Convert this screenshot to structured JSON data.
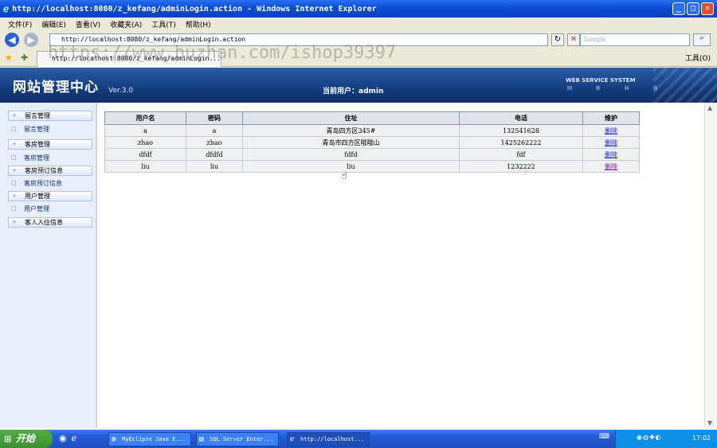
{
  "window": {
    "title": "http://localhost:8080/z_kefang/adminLogin.action - Windows Internet Explorer"
  },
  "menu": [
    "文件(F)",
    "编辑(E)",
    "查看(V)",
    "收藏夹(A)",
    "工具(T)",
    "帮助(H)"
  ],
  "address": {
    "url": "http://localhost:8080/z_kefang/adminLogin.action",
    "search_placeholder": "Google"
  },
  "tab": {
    "title": "http://localhost:8080/z_kefang/adminLogin..."
  },
  "watermark": "https://www.huzhan.com/ishop39397",
  "toolbar": {
    "tools_label": "工具(O)"
  },
  "header": {
    "logo": "网站管理中心",
    "version": "Ver.3.0",
    "current_user": "当前用户：admin",
    "system_name": "WEB SERVICE SYSTEM",
    "system_sub": "网 新 科 技"
  },
  "sidebar": {
    "items": [
      {
        "label": "留言管理",
        "kind": "head"
      },
      {
        "label": "留言管理",
        "kind": "sub"
      },
      {
        "label": "客房管理",
        "kind": "head"
      },
      {
        "label": "客房管理",
        "kind": "sub"
      },
      {
        "label": "客房预订信息",
        "kind": "head"
      },
      {
        "label": "客房预订信息",
        "kind": "sub"
      },
      {
        "label": "用户管理",
        "kind": "head"
      },
      {
        "label": "用户管理",
        "kind": "sub"
      },
      {
        "label": "客人入住信息",
        "kind": "head"
      }
    ]
  },
  "table": {
    "headers": [
      "用户名",
      "密码",
      "住址",
      "电话",
      "维护"
    ],
    "rows": [
      [
        "a",
        "a",
        "青岛四方区345#",
        "132541628",
        "删除"
      ],
      [
        "zhao",
        "zhao",
        "青岛市四方区哦哦山",
        "1425262222",
        "删除"
      ],
      [
        "dfdf",
        "dfdfd",
        "fdfd",
        "fdf",
        "删除"
      ],
      [
        "liu",
        "liu",
        "liu",
        "1232222",
        "删除"
      ]
    ]
  },
  "taskbar": {
    "start_label": "开始",
    "tasks": [
      "MyEclipse Java E...",
      "SQL Server Enter...",
      "http://localhost..."
    ],
    "clock": "17:02"
  }
}
